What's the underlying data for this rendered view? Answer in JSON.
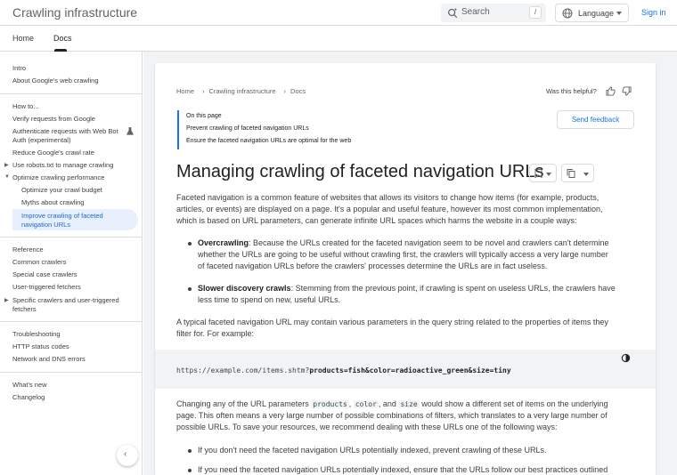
{
  "header": {
    "title": "Crawling infrastructure",
    "search_placeholder": "Search",
    "search_key": "/",
    "language": "Language",
    "signin": "Sign in"
  },
  "tabs": [
    {
      "label": "Home",
      "active": false
    },
    {
      "label": "Docs",
      "active": true
    }
  ],
  "sidebar": {
    "top": [
      "Intro",
      "About Google's web crawling"
    ],
    "howto_heading": "How to...",
    "howto": [
      "Verify requests from Google",
      "Authenticate requests with Web Bot Auth (experimental)",
      "Reduce Google's crawl rate",
      "Use robots.txt to manage crawling",
      "Optimize crawling performance"
    ],
    "optimize_sub": [
      "Optimize your crawl budget",
      "Myths about crawling",
      "Improve crawling of faceted navigation URLs"
    ],
    "reference_heading": "Reference",
    "reference": [
      "Common crawlers",
      "Special case crawlers",
      "User-triggered fetchers",
      "Specific crawlers and user-triggered fetchers"
    ],
    "troubleshooting_heading": "Troubleshooting",
    "troubleshooting": [
      "HTTP status codes",
      "Network and DNS errors"
    ],
    "bottom": [
      "What's new",
      "Changelog"
    ]
  },
  "breadcrumb": [
    "Home",
    "Crawling infrastructure",
    "Docs"
  ],
  "helpful": "Was this helpful?",
  "toc": {
    "title": "On this page",
    "links": [
      "Prevent crawling of faceted navigation URLs",
      "Ensure the faceted navigation URLs are optimal for the web"
    ]
  },
  "feedback": "Send feedback",
  "article": {
    "title": "Managing crawling of faceted navigation URLs",
    "intro_lines": [
      "Faceted navigation is a common feature of websites that allows its visitors to change how items (for example, products,",
      "articles, or events) are displayed on a page. It's a popular and useful feature, however its most common implementation,",
      "which is based on URL parameters, can generate infinite URL spaces which harms the website in a couple ways:"
    ],
    "bullets": [
      {
        "term": "Overcrawling",
        "lines": [
          ": Because the URLs created for the faceted navigation seem to be novel and crawlers can't determine",
          "whether the URLs are going to be useful without crawling first, the crawlers will typically access a very large number",
          "of faceted navigation URLs before the crawlers' processes determine the URLs are in fact useless."
        ]
      },
      {
        "term": "Slower discovery crawls",
        "lines": [
          ": Stemming from the previous point, if crawling is spent on useless URLs, the crawlers have",
          "less time to spend on new, useful URLs."
        ]
      }
    ],
    "typical_lines": [
      "A typical faceted navigation URL may contain various parameters in the query string related to the properties of items they",
      "filter for. For example:"
    ],
    "code_base": "https://example.com/items.shtm?",
    "code_params": "products=fish&color=radioactive_green&size=tiny",
    "changing": {
      "p1": "Changing any of the URL parameters ",
      "c1": "products",
      "p2": ", ",
      "c2": "color",
      "p3": ", and ",
      "c3": "size",
      "p4": " would show a different set of items on the underlying",
      "line2": "page. This often means a very large number of possible combinations of filters, which translates to a very large number of",
      "line3": "possible URLs. To save your resources, we recommend dealing with these URLs one of the following ways:"
    },
    "bullets2": [
      "If you don't need the faceted navigation URLs potentially indexed, prevent crawling of these URLs.",
      "If you need the faceted navigation URLs potentially indexed, ensure that the URLs follow our best practices outlined"
    ]
  }
}
